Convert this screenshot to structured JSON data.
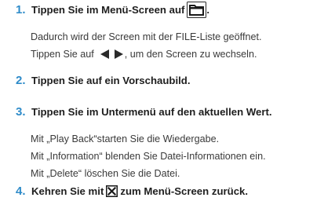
{
  "steps": [
    {
      "number": "1.",
      "text_before": "Tippen Sie im Menü-Screen auf",
      "text_after": ".",
      "details": [
        "Dadurch wird der Screen mit der FILE-Liste geöffnet.",
        {
          "before": "Tippen Sie auf",
          "after": ", um den Screen zu wechseln."
        }
      ]
    },
    {
      "number": "2.",
      "text": "Tippen Sie auf ein Vorschaubild."
    },
    {
      "number": "3.",
      "text": "Tippen Sie im Untermenü auf den aktuellen Wert.",
      "details": [
        "Mit „Play Back“starten Sie  die Wiedergabe.",
        "Mit „Information“ blenden Sie Datei-Informationen ein.",
        "Mit „Delete“ löschen Sie die Datei."
      ]
    },
    {
      "number": "4.",
      "text_before": "Kehren Sie mit",
      "text_after": "zum Menü-Screen zurück."
    }
  ],
  "icons": {
    "folder": "folder-icon",
    "left_arrow": "arrow-left-icon",
    "right_arrow": "arrow-right-icon",
    "close": "close-box-icon"
  },
  "colors": {
    "step_number": "#2e8bc9",
    "text": "#3a3a3a",
    "heading": "#1e1e1e"
  }
}
